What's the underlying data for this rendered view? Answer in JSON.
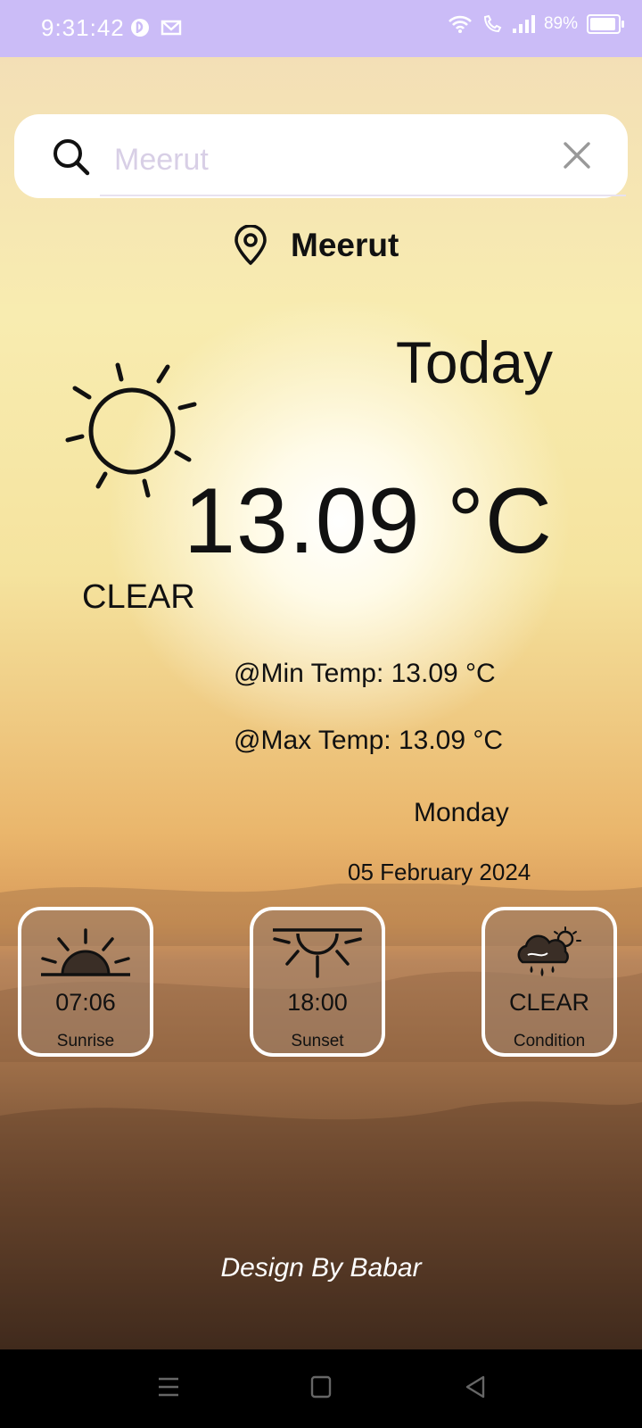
{
  "status_bar": {
    "time": "9:31:42",
    "battery": "89%",
    "battery_level": 0.89
  },
  "search": {
    "placeholder": "Meerut",
    "value": ""
  },
  "location": {
    "name": "Meerut"
  },
  "weather": {
    "heading": "Today",
    "temperature": "13.09 °C",
    "condition": "CLEAR",
    "min_temp": "@Min Temp: 13.09 °C",
    "max_temp": "@Max Temp: 13.09 °C",
    "day": "Monday",
    "date": "05 February 2024"
  },
  "cards": [
    {
      "value": "07:06",
      "label": "Sunrise",
      "icon": "sunrise-icon"
    },
    {
      "value": "18:00",
      "label": "Sunset",
      "icon": "sunset-icon"
    },
    {
      "value": "CLEAR",
      "label": "Condition",
      "icon": "cloud-sun-rain-icon"
    }
  ],
  "footer": {
    "credit": "Design By Babar"
  },
  "colors": {
    "status_bar": "#cbbcf7",
    "card_border": "#ffffff",
    "nav_bar": "#000000"
  }
}
